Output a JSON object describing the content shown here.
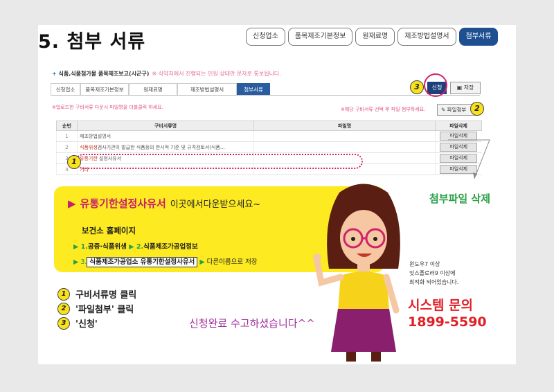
{
  "page_title": "5. 첨부 서류",
  "top_tabs": [
    {
      "label": "신청업소",
      "active": false
    },
    {
      "label": "품목제조기본정보",
      "active": false
    },
    {
      "label": "원재료명",
      "active": false
    },
    {
      "label": "제조방법설명서",
      "active": false
    },
    {
      "label": "첨부서류",
      "active": true
    }
  ],
  "form": {
    "subtitle": "식품,식품첨가물 품목제조보고(시군구)",
    "subtitle_note": "※ 식약처에서 진행되는 민원 상태만 문자로 통보됩니다.",
    "tabs": [
      "신청업소",
      "품목제조기본정보",
      "원재료명",
      "제조방법설명서",
      "첨부서류"
    ],
    "apply_label": "신청",
    "save_label": "저장",
    "upload_note": "※업로드한 구비서류 다운시 파일명을 더블클릭 하세요.",
    "attach_note": "※해당 구비서류 선택 후 파일 첨부하세요.",
    "attach_label": "파일첨부",
    "table": {
      "headers": [
        "순번",
        "구비서류명",
        "파일명",
        "파일삭제"
      ],
      "rows": [
        {
          "no": "1",
          "name_red": "",
          "name": "제조방법설명서",
          "file": "",
          "delete": "파일삭제"
        },
        {
          "no": "2",
          "name_red": "식품위생",
          "name": "검사기관이 발급한 식품등의 한시적 기준 및 규격검토서(식품…",
          "file": "",
          "delete": "파일삭제"
        },
        {
          "no": "3",
          "name_red": "유통기한",
          "name": " 설정사유서",
          "file": "",
          "delete": "파일삭제"
        },
        {
          "no": "4",
          "name_red": "기타",
          "name": "",
          "file": "",
          "delete": "파일삭제"
        }
      ]
    }
  },
  "markers": {
    "one": "1",
    "two": "2",
    "three": "3"
  },
  "callout": {
    "head": "유통기한설정사유서",
    "head_hand": "이곳에서다운받으세요~",
    "sub": "보건소 홈페이지",
    "bc1_step1": "1.",
    "bc1_item1": "공중·식품위생",
    "bc1_step2": "2.",
    "bc1_item2": "식품제조가공업정보",
    "bc2_step3": "3.",
    "bc2_item3": "식품제조가공업소 유통기한설정사유서",
    "bc2_tail": "다른이름으로 저장"
  },
  "delete_label": "첨부파일 삭제",
  "steps": [
    {
      "num": "1",
      "text": "구비서류명 클릭"
    },
    {
      "num": "2",
      "text": "'파일첨부' 클릭"
    },
    {
      "num": "3",
      "text": "'신청'"
    }
  ],
  "done_text": "신청완료 수고하셨습니다^^",
  "requirements": [
    "윈도우7 이상",
    "잇스플로러9 이상에",
    "최적화 되어있습니다."
  ],
  "system_inquiry": "시스템 문의",
  "system_phone": "1899-5590",
  "colors": {
    "accent": "#1d4f91",
    "magenta": "#d1226b",
    "yellow": "#fdea20",
    "green": "#2aa048",
    "red": "#e21f26"
  }
}
